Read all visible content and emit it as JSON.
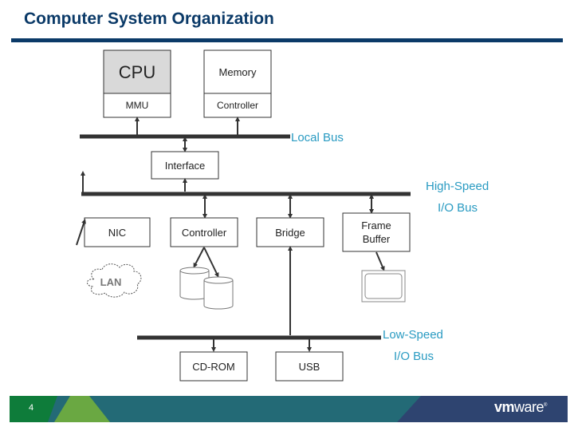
{
  "slide": {
    "title": "Computer System Organization",
    "page_number": "4",
    "logo": {
      "bold": "vm",
      "light": "ware",
      "mark": "®"
    }
  },
  "colors": {
    "title": "#0b3a68",
    "bus_label": "#2a9bc2",
    "footer_green": "#0e7c3a",
    "footer_light_green": "#6aa842",
    "footer_teal": "#236a76",
    "footer_navy": "#2e4470"
  },
  "components": {
    "cpu": {
      "top": "CPU",
      "bottom": "MMU"
    },
    "memory": {
      "top": "Memory",
      "bottom": "Controller"
    },
    "interface": "Interface",
    "nic": "NIC",
    "controller": "Controller",
    "bridge": "Bridge",
    "frame_buffer": [
      "Frame",
      "Buffer"
    ],
    "lan": "LAN",
    "cdrom": "CD-ROM",
    "usb": "USB"
  },
  "buses": {
    "local": "Local Bus",
    "high_speed": [
      "High-Speed",
      "I/O Bus"
    ],
    "low_speed": [
      "Low-Speed",
      "I/O Bus"
    ]
  }
}
